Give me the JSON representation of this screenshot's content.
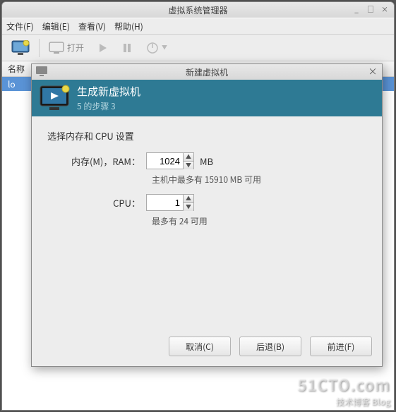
{
  "mainWindow": {
    "title": "虚拟系统管理器",
    "menus": {
      "file": "文件(F)",
      "edit": "编辑(E)",
      "view": "查看(V)",
      "help": "帮助(H)"
    },
    "toolbar": {
      "openLabel": "打开"
    },
    "columnHeader": "名称",
    "listRowVisible": "lo"
  },
  "dialog": {
    "title": "新建虚拟机",
    "header": {
      "line1": "生成新虚拟机",
      "line2": "5 的步骤 3"
    },
    "sectionLabel": "选择内存和 CPU 设置",
    "ram": {
      "label": "内存(M)，RAM：",
      "value": "1024",
      "unit": "MB",
      "hint": "主机中最多有 15910 MB 可用"
    },
    "cpu": {
      "label": "CPU：",
      "value": "1",
      "hint": "最多有 24 可用"
    },
    "buttons": {
      "cancel": "取消(C)",
      "back": "后退(B)",
      "forward": "前进(F)"
    }
  },
  "watermark": {
    "big": "51CTO.com",
    "small": "技术博客  Blog"
  }
}
